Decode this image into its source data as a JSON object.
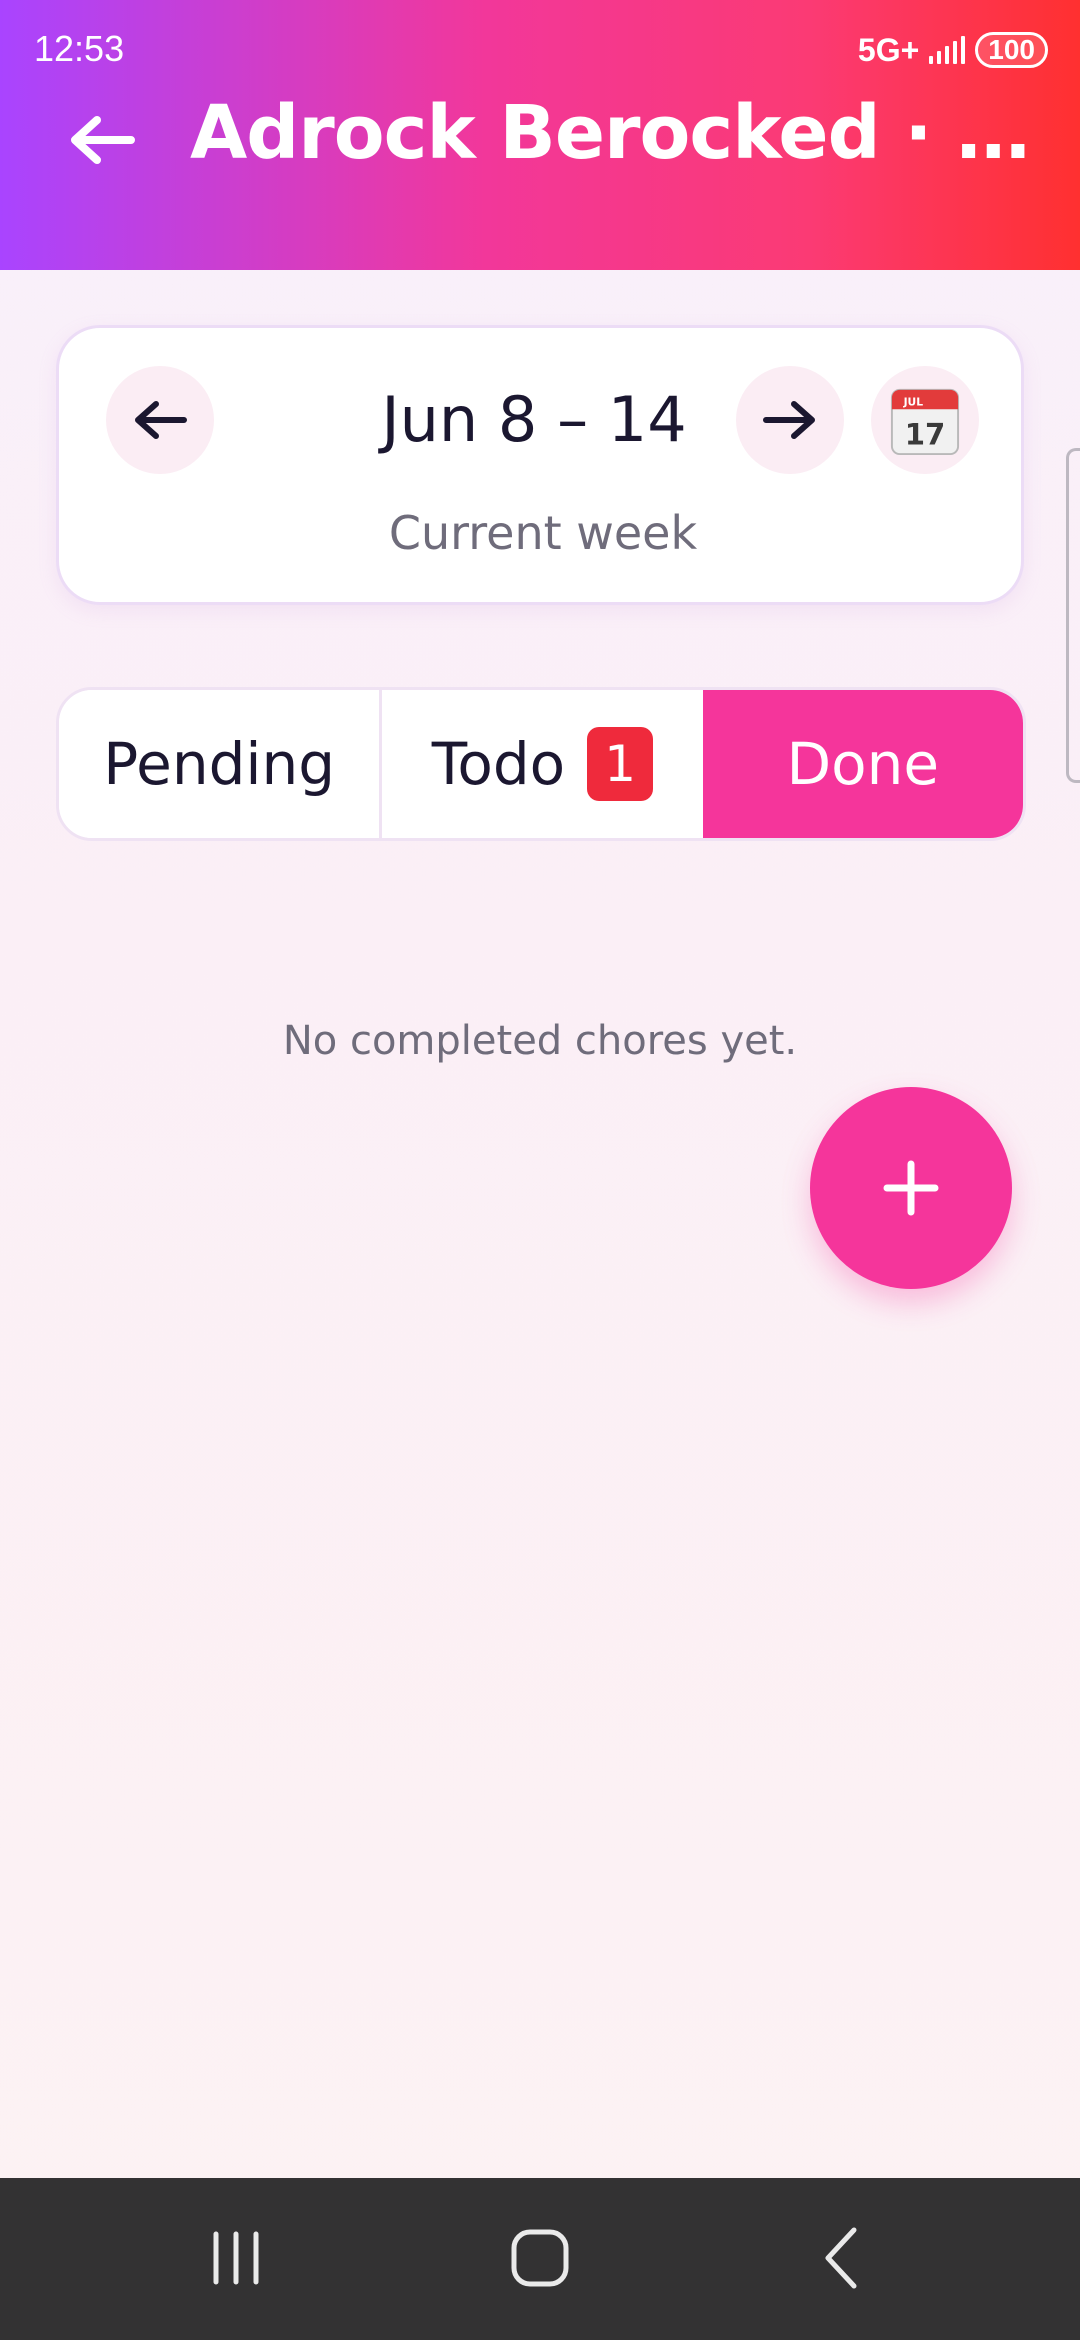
{
  "status_bar": {
    "time": "12:53",
    "network": "5G+",
    "battery": "100"
  },
  "header": {
    "title": "Adrock Berocked · Cho...",
    "back_icon": "arrow-left-icon"
  },
  "week_selector": {
    "range": "Jun 8 – 14",
    "subtitle": "Current week",
    "prev_icon": "arrow-left-icon",
    "next_icon": "arrow-right-icon",
    "calendar_icon": "calendar-icon",
    "calendar_icon_month": "JUL",
    "calendar_icon_day": "17"
  },
  "tabs": [
    {
      "label": "Pending",
      "active": false
    },
    {
      "label": "Todo",
      "badge": "1",
      "active": false
    },
    {
      "label": "Done",
      "active": true
    }
  ],
  "empty_message": "No completed chores yet.",
  "fab": {
    "icon": "plus-icon"
  },
  "colors": {
    "accent": "#f5359b",
    "header_gradient_start": "#a944ff",
    "header_gradient_end": "#ff3030",
    "badge": "#ef2a3c"
  },
  "nav_bar": {
    "recents_icon": "recents-icon",
    "home_icon": "home-icon",
    "back_icon": "back-chevron-icon"
  }
}
